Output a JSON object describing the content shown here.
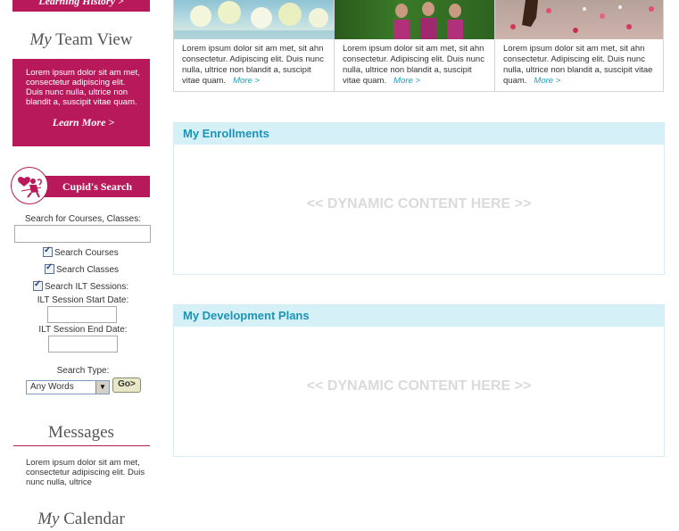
{
  "sidebar": {
    "history_link": "Learning History >",
    "team": {
      "title_em": "My",
      "title_rest": " Team View",
      "text": "Lorem ipsum dolor sit am met, consectetur adipiscing elit. Duis nunc nulla, ultrice non blandit a, suscipit vitae quam.",
      "learn_more": "Learn More >"
    },
    "cupid": {
      "title": "Cupid's Search",
      "search_label": "Search for Courses, Classes:",
      "search_value": "",
      "search_courses": "Search Courses",
      "search_classes": "Search Classes",
      "search_ilt": "Search ILT Sessions:",
      "start_label": "ILT Session Start Date:",
      "end_label": "ILT Session End Date:",
      "type_label": "Search Type:",
      "type_selected": "Any Words",
      "go": "Go>"
    },
    "messages": {
      "title": "Messages",
      "text": "Lorem ipsum dolor sit am met, consectetur adipiscing elit. Duis nunc nulla, ultrice"
    },
    "calendar": {
      "title_em": "My",
      "title_rest": " Calendar"
    }
  },
  "gallery": {
    "cards": [
      {
        "text": "Lorem ipsum dolor sit am met, sit ahn consectetur. Adipiscing elit. Duis nunc nulla, ultrice non blandit a, suscipit vitae quam.",
        "more": "More >"
      },
      {
        "text": "Lorem ipsum dolor sit am met, sit ahn consectetur. Adipiscing elit. Duis nunc nulla, ultrice non blandit a, suscipit vitae quam.",
        "more": "More >"
      },
      {
        "text": "Lorem ipsum dolor sit am met, sit ahn consectetur. Adipiscing elit. Duis nunc nulla, ultrice non blandit a, suscipit vitae quam.",
        "more": "More >"
      }
    ]
  },
  "enrollments": {
    "title": "My Enrollments",
    "placeholder": "<< DYNAMIC CONTENT HERE >>"
  },
  "development": {
    "title": "My Development Plans",
    "placeholder": "<< DYNAMIC CONTENT HERE >>"
  },
  "colors": {
    "brand": "#b8195a",
    "accent": "#1b94b8",
    "panel_header": "#d6f0f7"
  }
}
